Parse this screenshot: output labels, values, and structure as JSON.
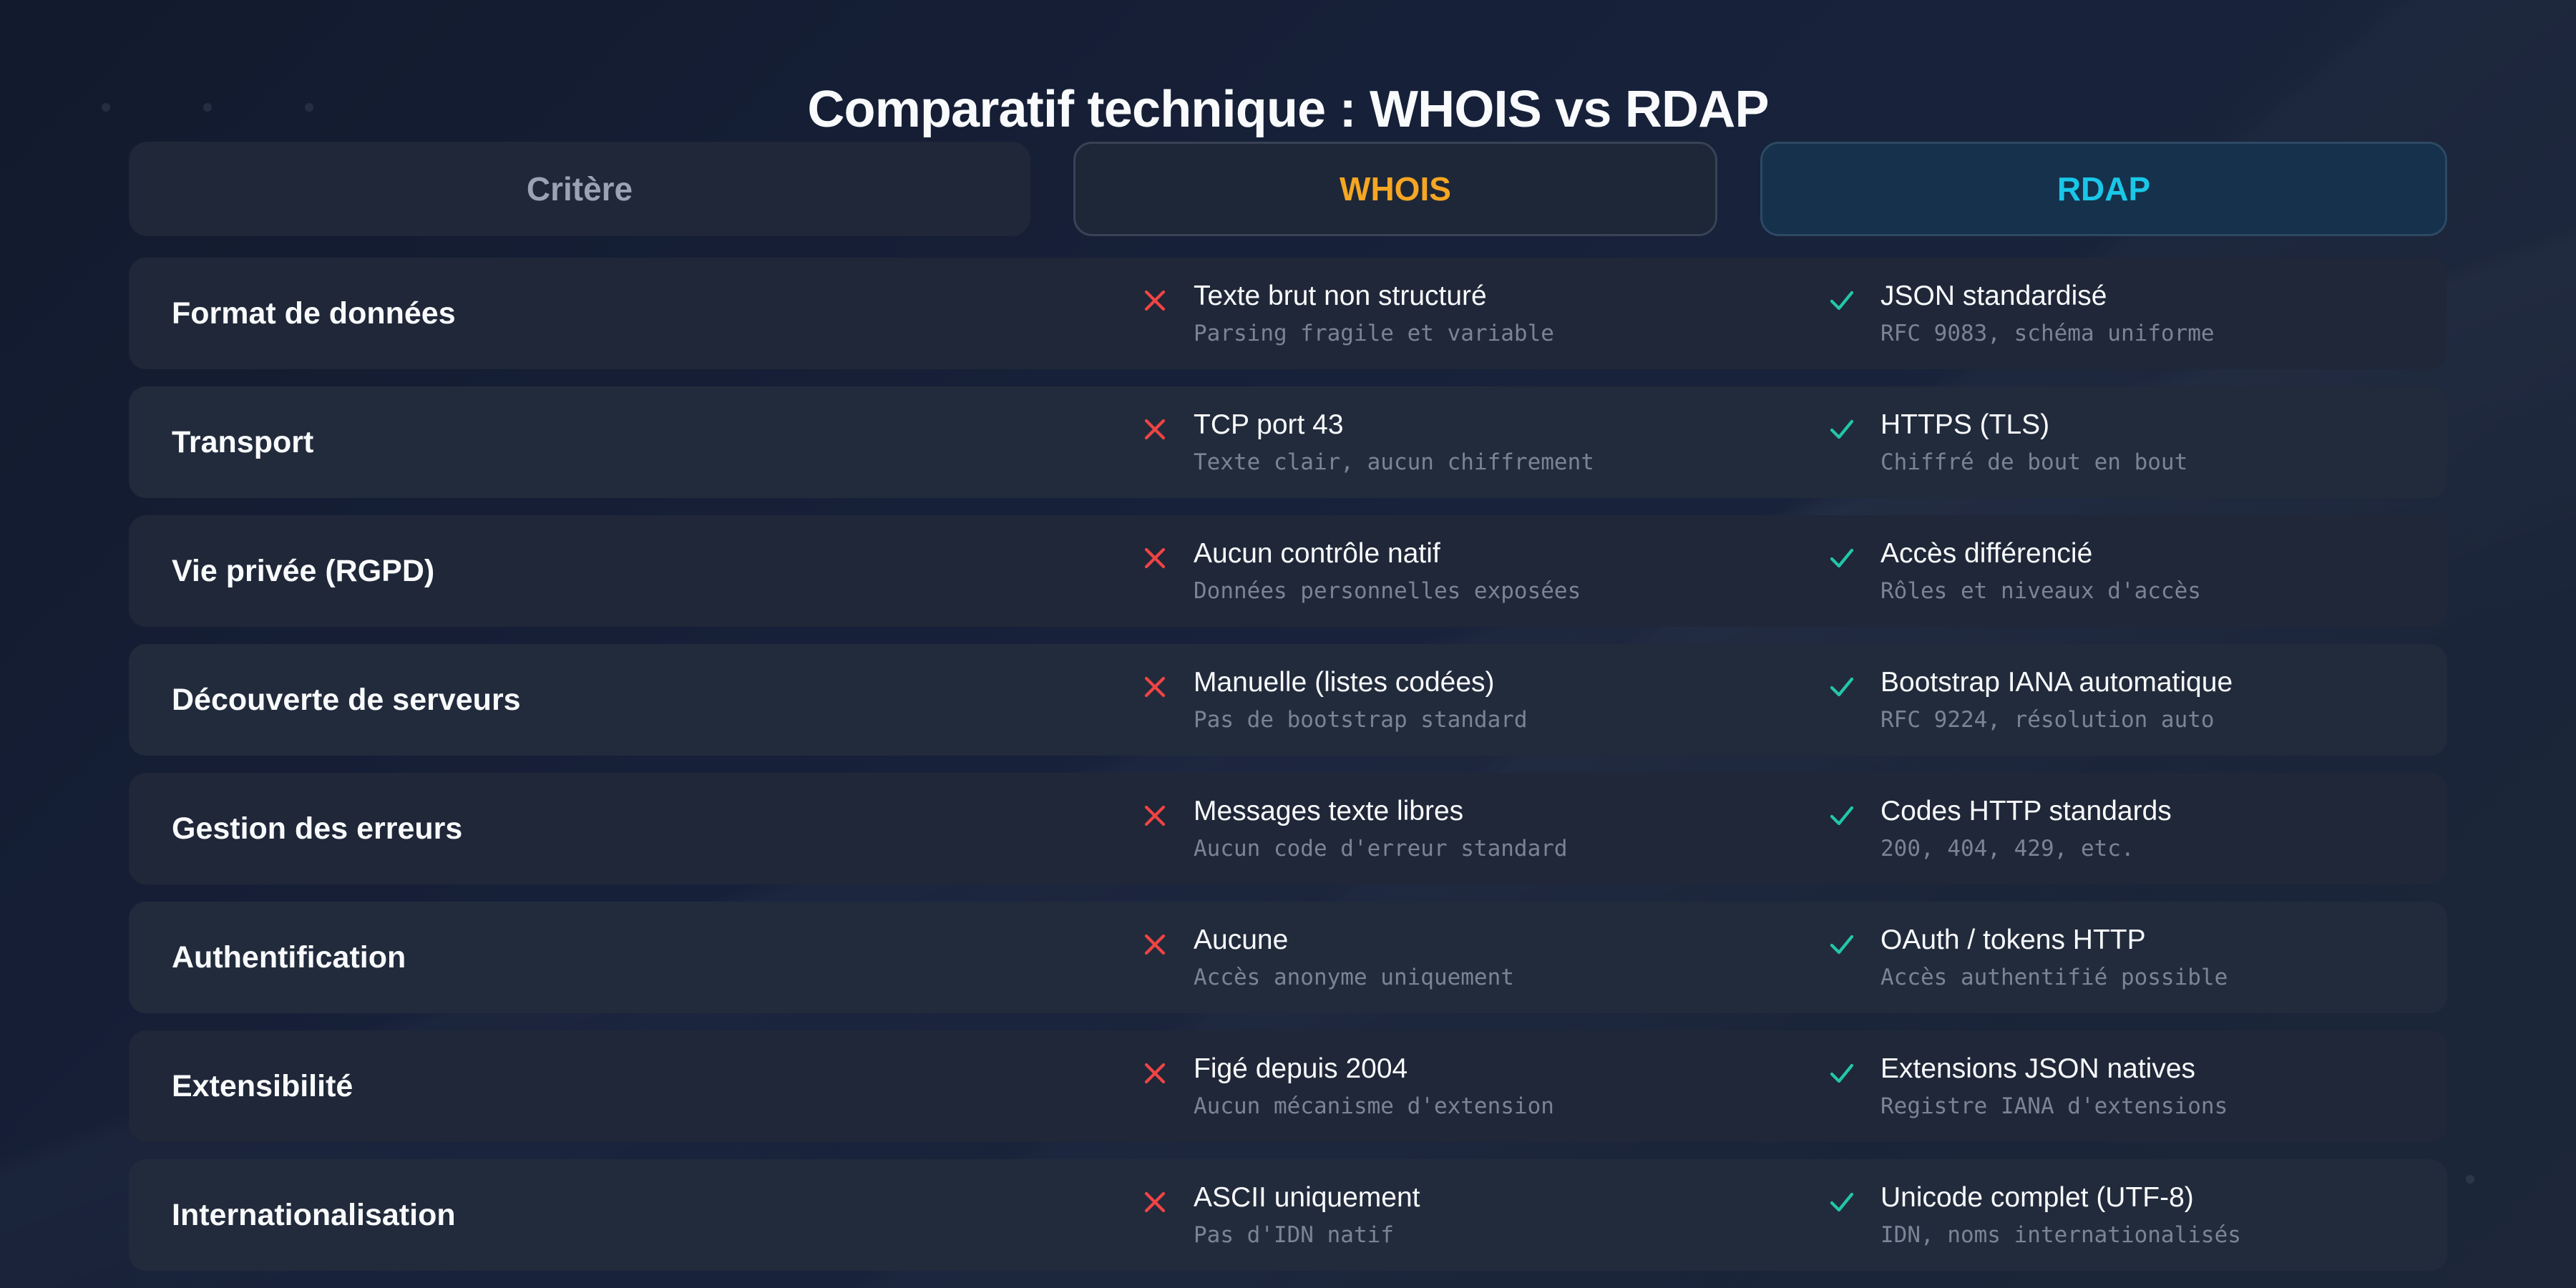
{
  "title": "Comparatif technique : WHOIS vs RDAP",
  "header": {
    "criterion": "Critère",
    "whois": "WHOIS",
    "rdap": "RDAP"
  },
  "colors": {
    "whois_accent": "#f5a623",
    "rdap_accent": "#19c7e8",
    "cross": "#ef4444",
    "check": "#22c7a9"
  },
  "rows": [
    {
      "criterion": "Format de données",
      "whois": {
        "icon": "cross-icon",
        "main": "Texte brut non structuré",
        "sub": "Parsing fragile et variable"
      },
      "rdap": {
        "icon": "check-icon",
        "main": "JSON standardisé",
        "sub": "RFC 9083, schéma uniforme"
      }
    },
    {
      "criterion": "Transport",
      "whois": {
        "icon": "cross-icon",
        "main": "TCP port 43",
        "sub": "Texte clair, aucun chiffrement"
      },
      "rdap": {
        "icon": "check-icon",
        "main": "HTTPS (TLS)",
        "sub": "Chiffré de bout en bout"
      }
    },
    {
      "criterion": "Vie privée (RGPD)",
      "whois": {
        "icon": "cross-icon",
        "main": "Aucun contrôle natif",
        "sub": "Données personnelles exposées"
      },
      "rdap": {
        "icon": "check-icon",
        "main": "Accès différencié",
        "sub": "Rôles et niveaux d'accès"
      }
    },
    {
      "criterion": "Découverte de serveurs",
      "whois": {
        "icon": "cross-icon",
        "main": "Manuelle (listes codées)",
        "sub": "Pas de bootstrap standard"
      },
      "rdap": {
        "icon": "check-icon",
        "main": "Bootstrap IANA automatique",
        "sub": "RFC 9224, résolution auto"
      }
    },
    {
      "criterion": "Gestion des erreurs",
      "whois": {
        "icon": "cross-icon",
        "main": "Messages texte libres",
        "sub": "Aucun code d'erreur standard"
      },
      "rdap": {
        "icon": "check-icon",
        "main": "Codes HTTP standards",
        "sub": "200, 404, 429, etc."
      }
    },
    {
      "criterion": "Authentification",
      "whois": {
        "icon": "cross-icon",
        "main": "Aucune",
        "sub": "Accès anonyme uniquement"
      },
      "rdap": {
        "icon": "check-icon",
        "main": "OAuth / tokens HTTP",
        "sub": "Accès authentifié possible"
      }
    },
    {
      "criterion": "Extensibilité",
      "whois": {
        "icon": "cross-icon",
        "main": "Figé depuis 2004",
        "sub": "Aucun mécanisme d'extension"
      },
      "rdap": {
        "icon": "check-icon",
        "main": "Extensions JSON natives",
        "sub": "Registre IANA d'extensions"
      }
    },
    {
      "criterion": "Internationalisation",
      "whois": {
        "icon": "cross-icon",
        "main": "ASCII uniquement",
        "sub": "Pas d'IDN natif"
      },
      "rdap": {
        "icon": "check-icon",
        "main": "Unicode complet (UTF-8)",
        "sub": "IDN, noms internationalisés"
      }
    }
  ]
}
